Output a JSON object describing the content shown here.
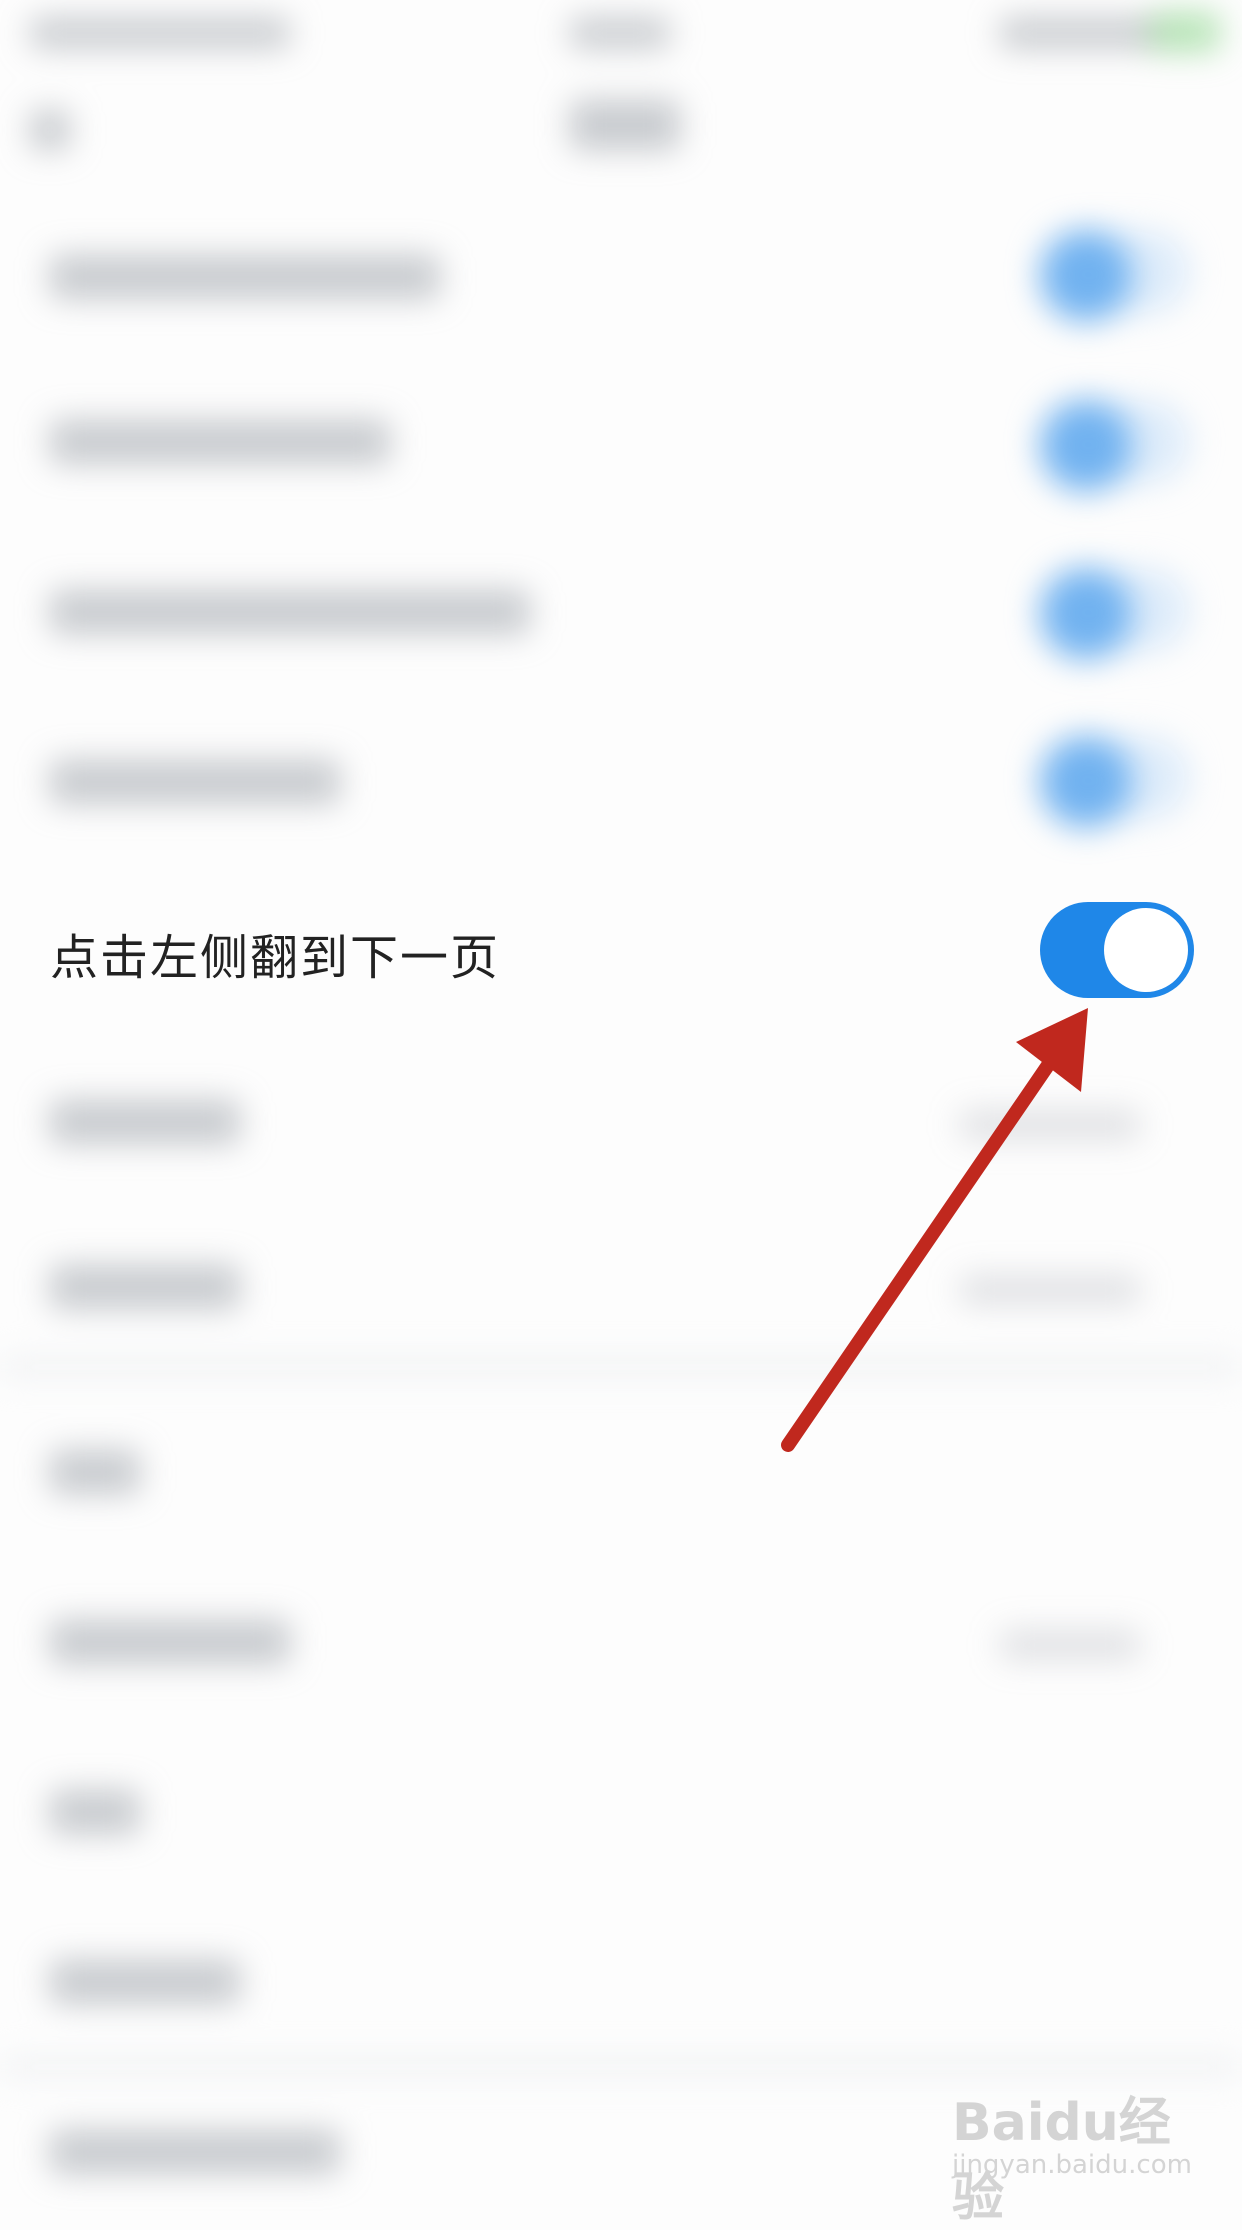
{
  "settings": {
    "focused_item": {
      "label": "点击左侧翻到下一页",
      "toggle_on": true
    }
  },
  "watermark": {
    "brand_text": "Baidu经验",
    "url": "jingyan.baidu.com"
  },
  "colors": {
    "toggle_on": "#1f87e8",
    "arrow": "#c0281e",
    "background": "#fdfdfd"
  }
}
